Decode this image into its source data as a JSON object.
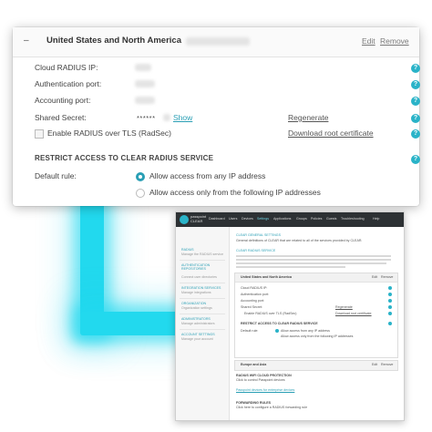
{
  "radius_card": {
    "collapse_glyph": "–",
    "region_title": "United States and North America",
    "edit_label": "Edit",
    "remove_label": "Remove",
    "fields": {
      "cloud_ip_label": "Cloud RADIUS IP:",
      "auth_port_label": "Authentication port:",
      "acct_port_label": "Accounting port:",
      "secret_label": "Shared Secret:",
      "secret_masked": "******",
      "show_label": "Show",
      "regenerate_label": "Regenerate",
      "radsec_label": "Enable RADIUS over TLS (RadSec)",
      "download_cert_label": "Download root certificate"
    },
    "restrict_title": "RESTRICT ACCESS TO CLEAR RADIUS SERVICE",
    "default_rule_label": "Default rule:",
    "rule_options": [
      {
        "label": "Allow access from any IP address",
        "selected": true
      },
      {
        "label": "Allow access only from the following IP addresses",
        "selected": false
      }
    ],
    "help_glyph": "?"
  },
  "app_screenshot": {
    "brand_line1": "passpoint",
    "brand_line2": "CLEAR",
    "nav": [
      "Dashboard",
      "Users",
      "Devices",
      "Settings",
      "Applications",
      "Groups",
      "Policies",
      "Guests",
      "Troubleshooting",
      "Help"
    ],
    "active_nav": "Settings",
    "sidebar": [
      {
        "title": "RADIUS",
        "sub": "Manage the RADIUS service"
      },
      {
        "title": "AUTHENTICATION REPOSITORIES",
        "sub": "Connect user directories"
      },
      {
        "title": "INTEGRATION SERVICES",
        "sub": "Manage integrations"
      },
      {
        "title": "ORGANIZATION",
        "sub": "Organization settings"
      },
      {
        "title": "ADMINISTRATORS",
        "sub": "Manage administrators"
      },
      {
        "title": "ACCOUNT SETTINGS",
        "sub": "Manage your account"
      }
    ],
    "section1": "CLEAR GENERAL SETTINGS",
    "section1_desc": "General definitions of CLEAR that are related to all of the services provided by CLEAR.",
    "section2": "CLEAR RADIUS SERVICE",
    "region": "United States and North America",
    "edit_label": "Edit",
    "remove_label": "Remove",
    "fields": [
      "Cloud RADIUS IP:",
      "Authentication port:",
      "Accounting port:",
      "Shared Secret:"
    ],
    "regenerate_label": "Regenerate",
    "download_label": "Download root certificate",
    "radsec_label": "Enable RADIUS over TLS (RadSec)",
    "restrict_title": "RESTRICT ACCESS TO CLEAR RADIUS SERVICE",
    "default_rule": "Default rule:",
    "rule_options": [
      "Allow access from any IP address",
      "Allow access only from the following IP addresses"
    ],
    "region2": "Europe and Asia",
    "edit2": "Edit",
    "remove2": "Remove",
    "wifi_title": "RADIUS WIFI CLOUD PROTECTION",
    "wifi_desc": "Click to control Passpoint devices",
    "wifi_link": "Passpoint devices for enterprise devices",
    "forwarding_title": "FORWARDING RULES",
    "forwarding_desc": "Click here to configure a RADIUS forwarding rule"
  }
}
